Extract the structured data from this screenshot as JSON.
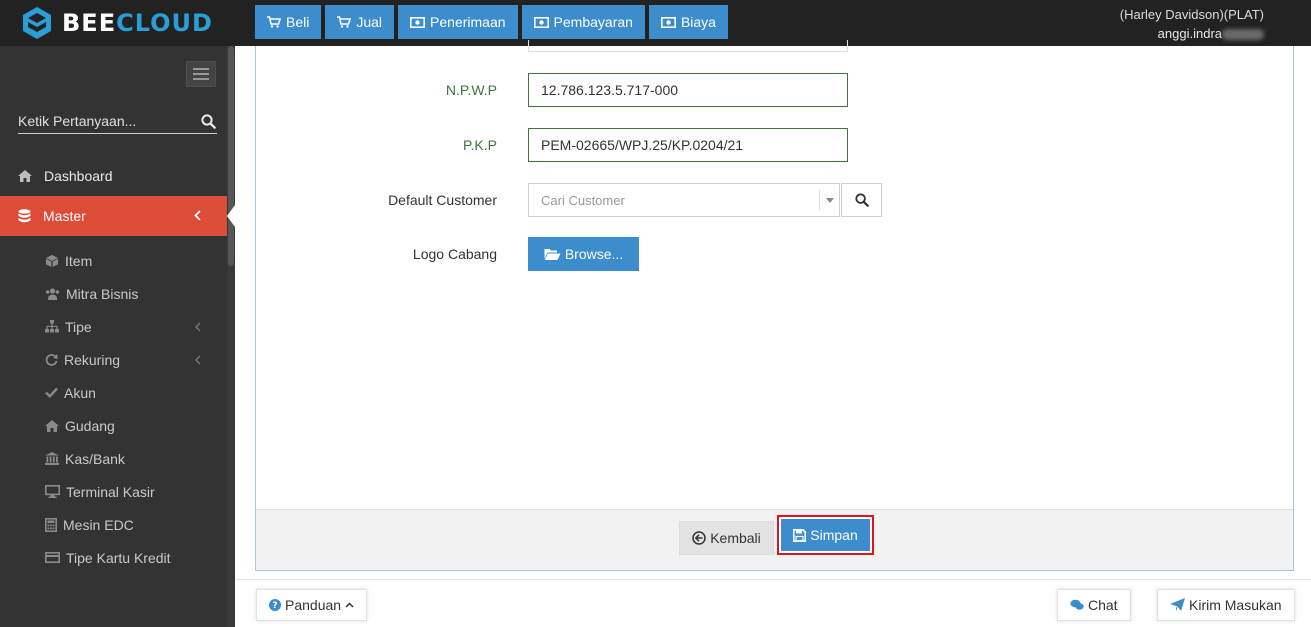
{
  "brand": {
    "part1": "BEE",
    "part2": "CLOUD"
  },
  "header": {
    "actions": [
      {
        "label": "Beli",
        "icon": "cart-icon"
      },
      {
        "label": "Jual",
        "icon": "cart-icon"
      },
      {
        "label": "Penerimaan",
        "icon": "money-icon"
      },
      {
        "label": "Pembayaran",
        "icon": "money-icon"
      },
      {
        "label": "Biaya",
        "icon": "money-icon"
      }
    ],
    "company": "(Harley Davidson)(PLAT)",
    "user_prefix": "anggi.indra"
  },
  "sidebar": {
    "search_placeholder": "Ketik Pertanyaan...",
    "dashboard": "Dashboard",
    "master": "Master",
    "submenu": [
      {
        "label": "Item",
        "icon": "cube-icon"
      },
      {
        "label": "Mitra Bisnis",
        "icon": "users-icon"
      },
      {
        "label": "Tipe",
        "icon": "sitemap-icon",
        "has_children": true
      },
      {
        "label": "Rekuring",
        "icon": "refresh-icon",
        "has_children": true
      },
      {
        "label": "Akun",
        "icon": "check-icon"
      },
      {
        "label": "Gudang",
        "icon": "home-icon"
      },
      {
        "label": "Kas/Bank",
        "icon": "bank-icon"
      },
      {
        "label": "Terminal Kasir",
        "icon": "desktop-icon"
      },
      {
        "label": "Mesin EDC",
        "icon": "calculator-icon"
      },
      {
        "label": "Tipe Kartu Kredit",
        "icon": "credit-card-icon"
      }
    ]
  },
  "form": {
    "npwp_label": "N.P.W.P",
    "npwp_value": "12.786.123.5.717-000",
    "pkp_label": "P.K.P",
    "pkp_value": "PEM-02665/WPJ.25/KP.0204/21",
    "customer_label": "Default Customer",
    "customer_placeholder": "Cari Customer",
    "logo_label": "Logo Cabang",
    "browse_label": "Browse..."
  },
  "footer": {
    "back_label": "Kembali",
    "save_label": "Simpan"
  },
  "bottom": {
    "guide_label": "Panduan",
    "chat_label": "Chat",
    "feedback_label": "Kirim Masukan"
  },
  "colors": {
    "primary": "#3c8dcd",
    "active": "#dd4b39",
    "sidebar": "#333333",
    "success": "#3c763d",
    "highlight": "#e0141e"
  }
}
